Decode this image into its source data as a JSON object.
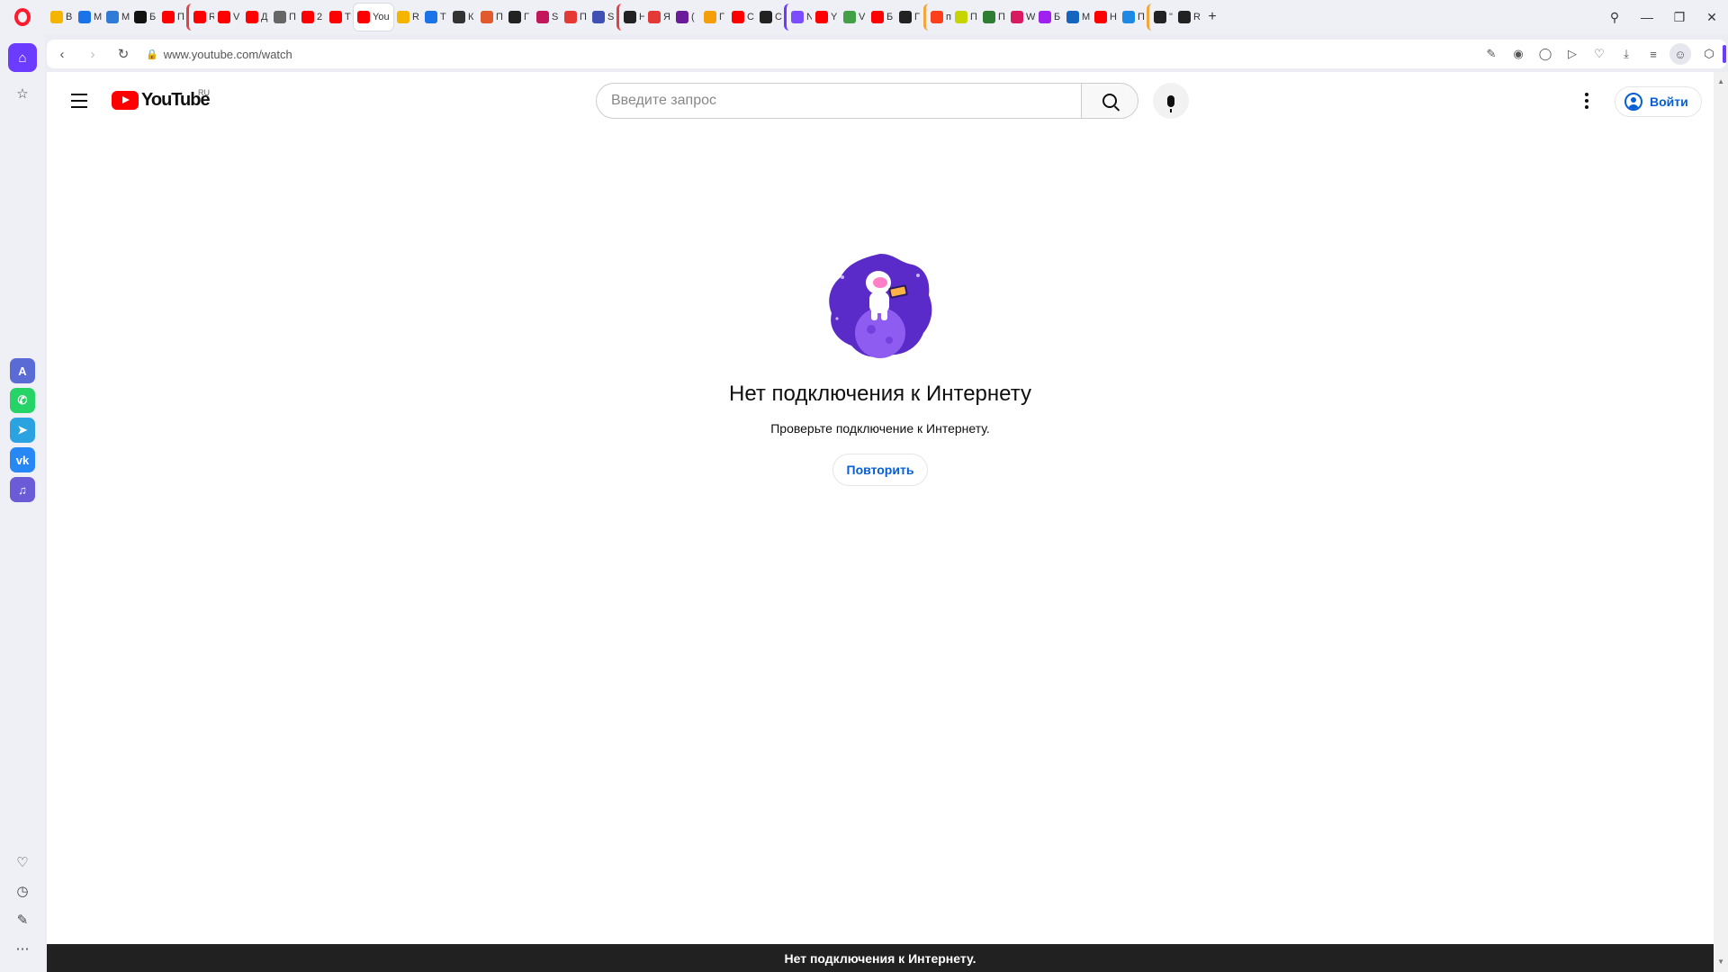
{
  "browser": {
    "address": {
      "url": "www.youtube.com/watch"
    },
    "tabs": [
      {
        "label": "В",
        "color": "#f4b400",
        "group": ""
      },
      {
        "label": "М",
        "color": "#1a73e8",
        "group": ""
      },
      {
        "label": "М",
        "color": "#2f7bd6",
        "group": ""
      },
      {
        "label": "Б",
        "color": "#111111",
        "group": ""
      },
      {
        "label": "П",
        "color": "#ff0000",
        "group": ""
      },
      {
        "label": "R",
        "color": "#ff0000",
        "group": "grp"
      },
      {
        "label": "V",
        "color": "#ff0000",
        "group": ""
      },
      {
        "label": "Д",
        "color": "#ff0000",
        "group": ""
      },
      {
        "label": "П",
        "color": "#666666",
        "group": ""
      },
      {
        "label": "2",
        "color": "#ff0000",
        "group": ""
      },
      {
        "label": "Т",
        "color": "#ff0000",
        "group": ""
      },
      {
        "label": "You",
        "color": "#ff0000",
        "group": "",
        "active": true
      },
      {
        "label": "R",
        "color": "#f4b400",
        "group": ""
      },
      {
        "label": "Т",
        "color": "#1a73e8",
        "group": ""
      },
      {
        "label": "К",
        "color": "#333333",
        "group": ""
      },
      {
        "label": "П",
        "color": "#e05a2b",
        "group": ""
      },
      {
        "label": "Г",
        "color": "#222222",
        "group": ""
      },
      {
        "label": "S",
        "color": "#c2185b",
        "group": ""
      },
      {
        "label": "П",
        "color": "#e53935",
        "group": ""
      },
      {
        "label": "S",
        "color": "#3f51b5",
        "group": ""
      },
      {
        "label": "Н",
        "color": "#222222",
        "group": "grp"
      },
      {
        "label": "Я",
        "color": "#e53935",
        "group": ""
      },
      {
        "label": "(",
        "color": "#6a1b9a",
        "group": ""
      },
      {
        "label": "Г",
        "color": "#f59e0b",
        "group": ""
      },
      {
        "label": "С",
        "color": "#ff0000",
        "group": ""
      },
      {
        "label": "С",
        "color": "#222222",
        "group": ""
      },
      {
        "label": "N",
        "color": "#7c4dff",
        "group": "grp2"
      },
      {
        "label": "Y",
        "color": "#ff0000",
        "group": ""
      },
      {
        "label": "V",
        "color": "#43a047",
        "group": ""
      },
      {
        "label": "Б",
        "color": "#ff0000",
        "group": ""
      },
      {
        "label": "Г",
        "color": "#222222",
        "group": ""
      },
      {
        "label": "п",
        "color": "#fc3f1d",
        "group": "grp3"
      },
      {
        "label": "П",
        "color": "#c6d400",
        "group": ""
      },
      {
        "label": "П",
        "color": "#2e7d32",
        "group": ""
      },
      {
        "label": "W",
        "color": "#d81b60",
        "group": ""
      },
      {
        "label": "Б",
        "color": "#a020f0",
        "group": ""
      },
      {
        "label": "М",
        "color": "#1565c0",
        "group": ""
      },
      {
        "label": "Н",
        "color": "#ff0000",
        "group": ""
      },
      {
        "label": "П",
        "color": "#1e88e5",
        "group": ""
      },
      {
        "label": "\"",
        "color": "#222222",
        "group": "grp3"
      },
      {
        "label": "R",
        "color": "#222222",
        "group": ""
      }
    ],
    "sidebar_apps": [
      {
        "name": "aria",
        "color": "#5b6bd6",
        "glyph": "A"
      },
      {
        "name": "whatsapp",
        "color": "#25d366",
        "glyph": "✆"
      },
      {
        "name": "telegram",
        "color": "#2aa3e0",
        "glyph": "➤"
      },
      {
        "name": "vk",
        "color": "#2787f5",
        "glyph": "vk"
      },
      {
        "name": "music",
        "color": "#6b5bd6",
        "glyph": "♫"
      }
    ]
  },
  "youtube": {
    "logo_text": "YouTube",
    "region": "RU",
    "search_placeholder": "Введите запрос",
    "signin_label": "Войти"
  },
  "offline": {
    "title": "Нет подключения к Интернету",
    "subtitle": "Проверьте подключение к Интернету.",
    "retry_label": "Повторить"
  },
  "toast": {
    "message": "Нет подключения к Интернету."
  },
  "colors": {
    "opera_red": "#ff1b2d",
    "accent": "#6b3bff",
    "yt_red": "#ff0000",
    "yt_blue": "#065fd4"
  }
}
